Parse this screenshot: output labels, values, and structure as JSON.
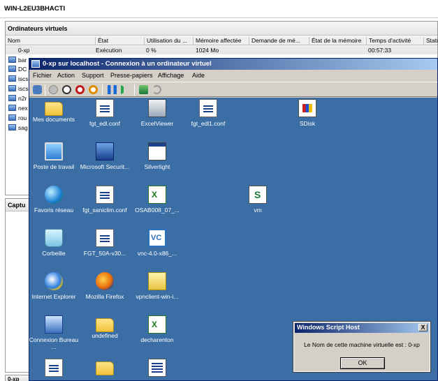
{
  "server": {
    "title": "WIN-L2EU3BHACTI"
  },
  "vm_panel": {
    "title": "Ordinateurs virtuels",
    "columns": [
      "Nom",
      "État",
      "Utilisation du ...",
      "Mémoire affectée",
      "Demande de mé...",
      "État de la mémoire",
      "Temps d'activité",
      "Statu"
    ],
    "selected_row": {
      "name": "0-xp",
      "state": "Exécution",
      "cpu": "0 %",
      "memory": "1024 Mo",
      "uptime": "00:57:33"
    },
    "other_rows": [
      "bar",
      "DC",
      "iscs",
      "iscs",
      "n2r",
      "nex",
      "rou",
      "sag"
    ]
  },
  "capture_panel": {
    "title": "Captu"
  },
  "bottom_tab": {
    "title": "0-xp"
  },
  "vm_window": {
    "title": "0-xp sur localhost - Connexion à un ordinateur virtuel",
    "menu": [
      "Fichier",
      "Action",
      "Support",
      "Presse-papiers",
      "Affichage",
      "Aide"
    ]
  },
  "desktop": {
    "icons": [
      {
        "label": "Mes documents",
        "glyph": "g-folder"
      },
      {
        "label": "fgt_edl.conf",
        "glyph": "g-doc"
      },
      {
        "label": "ExcelViewer",
        "glyph": "g-server"
      },
      {
        "label": "fgt_edl1.conf",
        "glyph": "g-doc"
      },
      {
        "label": "SDisk",
        "glyph": "g-sdisk"
      },
      {
        "label": "Poste de travail",
        "glyph": "g-monitor"
      },
      {
        "label": "Microsoft Securit...",
        "glyph": "g-sec"
      },
      {
        "label": "Silverlight",
        "glyph": "g-silver"
      },
      {
        "label": "Favoris réseau",
        "glyph": "g-globe"
      },
      {
        "label": "fgt_saniclim.conf",
        "glyph": "g-doc"
      },
      {
        "label": "OSAB008_07_...",
        "glyph": "g-xls"
      },
      {
        "label": "vm",
        "glyph": "g-s"
      },
      {
        "label": "Corbeille",
        "glyph": "g-bin"
      },
      {
        "label": "FGT_50A-v30...",
        "glyph": "g-doc"
      },
      {
        "label": "vnc-4.0-x86_...",
        "glyph": "g-vnc"
      },
      {
        "label": "Internet Explorer",
        "glyph": "g-ie"
      },
      {
        "label": "Mozilla Firefox",
        "glyph": "g-ff"
      },
      {
        "label": "vpnclient-win-i...",
        "glyph": "g-zip"
      },
      {
        "label": "Connexion Bureau ...",
        "glyph": "g-rdp"
      },
      {
        "label": "undefined",
        "glyph": "g-folder"
      },
      {
        "label": "decharenton",
        "glyph": "g-xls"
      },
      {
        "label": "",
        "glyph": "g-doc"
      },
      {
        "label": "",
        "glyph": "g-folder"
      },
      {
        "label": "",
        "glyph": "g-list"
      }
    ]
  },
  "msgbox": {
    "title": "Windows Script Host",
    "message": "Le Nom de cette machine virtuelle est : 0-xp",
    "ok_label": "OK",
    "close_label": "X"
  }
}
